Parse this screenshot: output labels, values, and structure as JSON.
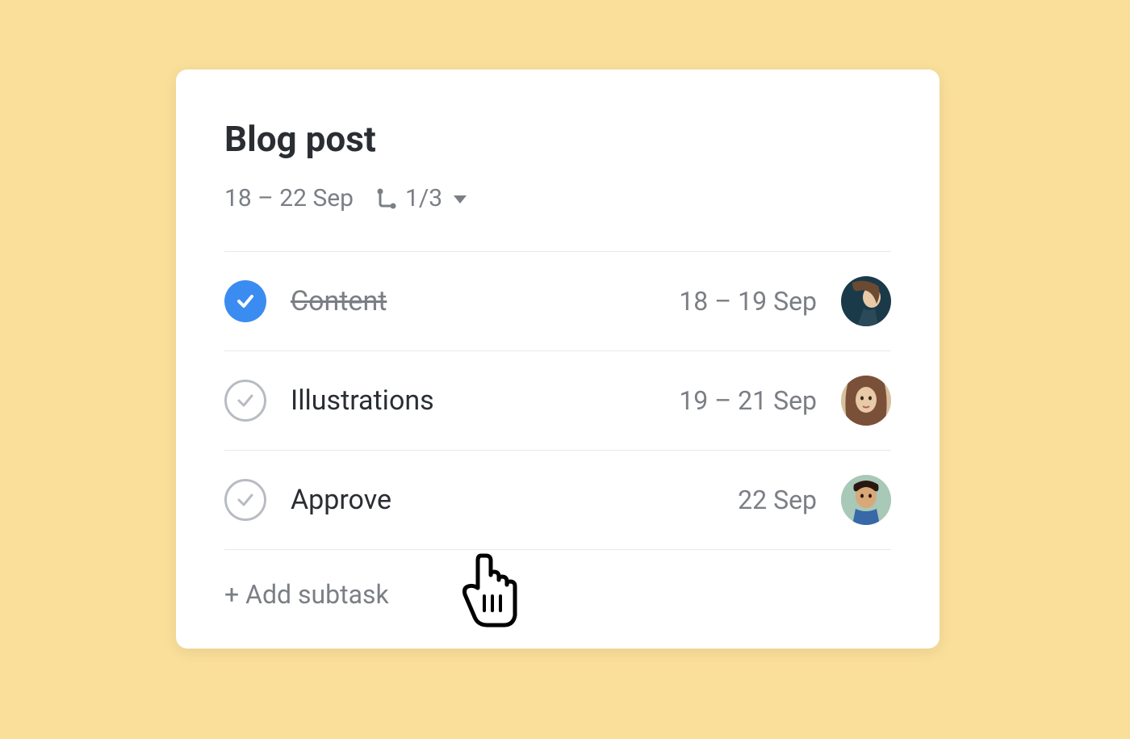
{
  "card": {
    "title": "Blog post",
    "date_range": "18 – 22 Sep",
    "subtask_count": "1/3"
  },
  "subtasks": [
    {
      "name": "Content",
      "date": "18 – 19 Sep",
      "done": true
    },
    {
      "name": "Illustrations",
      "date": "19 – 21 Sep",
      "done": false
    },
    {
      "name": "Approve",
      "date": "22 Sep",
      "done": false
    }
  ],
  "actions": {
    "add_subtask": "+ Add subtask"
  }
}
